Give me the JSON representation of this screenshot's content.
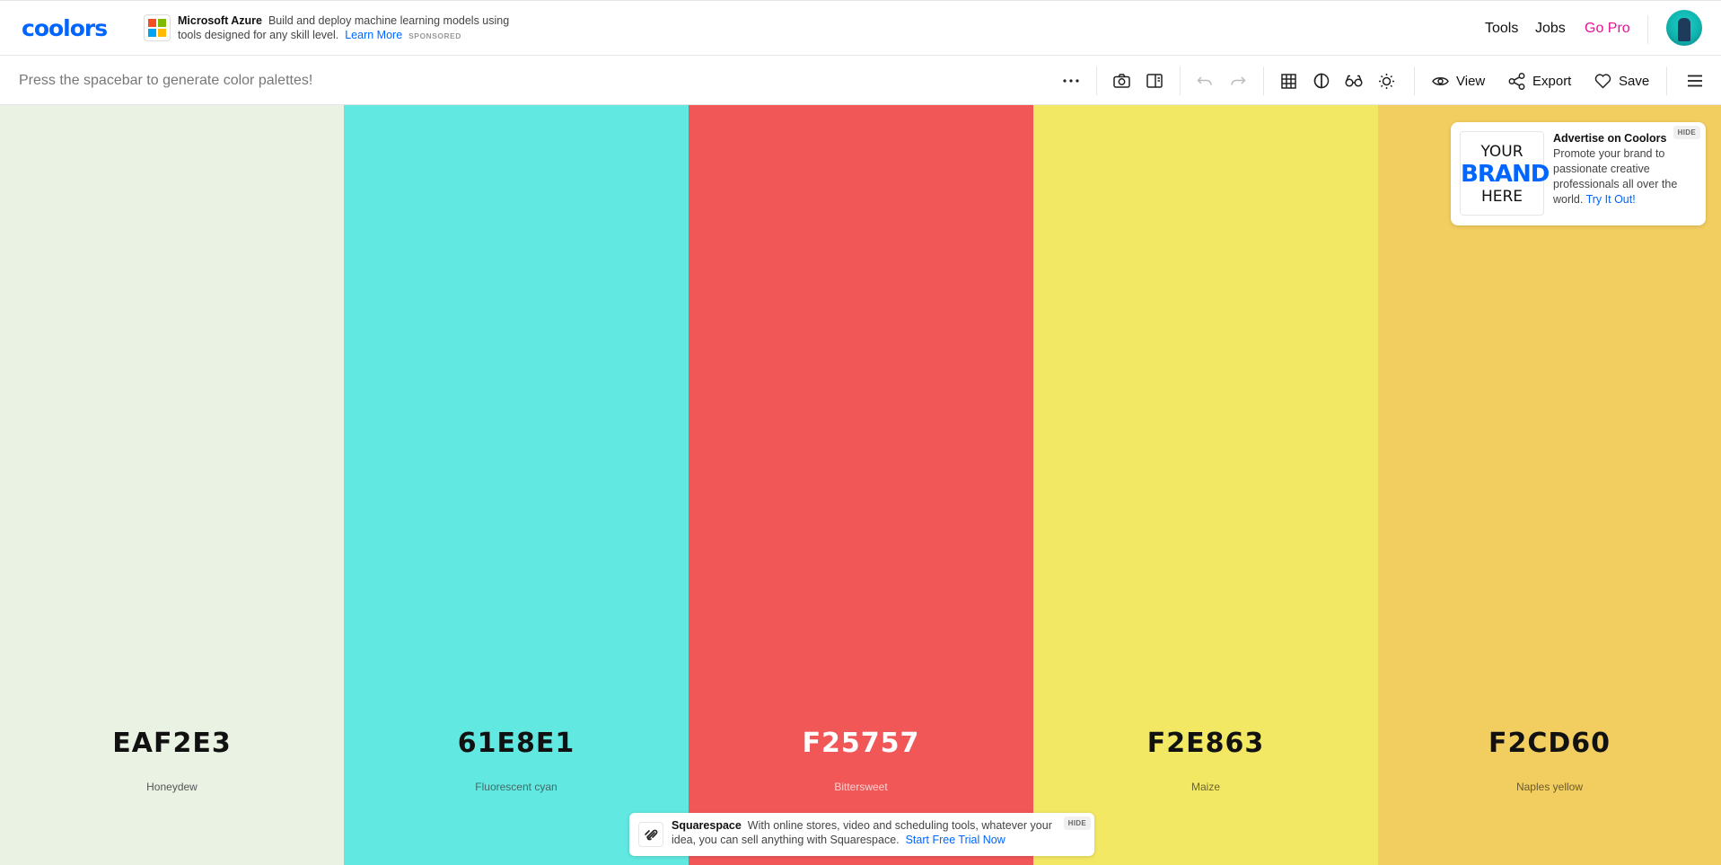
{
  "nav": {
    "logo": "coolors",
    "sponsor": {
      "brand": "Microsoft Azure",
      "text": "Build and deploy machine learning models using tools designed for any skill level.",
      "link": "Learn More",
      "tag": "SPONSORED"
    },
    "links": {
      "tools": "Tools",
      "jobs": "Jobs",
      "gopro": "Go Pro"
    }
  },
  "toolbar": {
    "hint": "Press the spacebar to generate color palettes!",
    "view": "View",
    "export": "Export",
    "save": "Save"
  },
  "palette": [
    {
      "hex": "EAF2E3",
      "name": "Honeydew",
      "bg": "#EAF2E3",
      "fg": "#111111",
      "sub": "#555555"
    },
    {
      "hex": "61E8E1",
      "name": "Fluorescent cyan",
      "bg": "#61E8E1",
      "fg": "#111111",
      "sub": "#3f6b69"
    },
    {
      "hex": "F25757",
      "name": "Bittersweet",
      "bg": "#F25757",
      "fg": "#ffffff",
      "sub": "#fbd0d0"
    },
    {
      "hex": "F2E863",
      "name": "Maize",
      "bg": "#F2E863",
      "fg": "#111111",
      "sub": "#6b6630"
    },
    {
      "hex": "F2CD60",
      "name": "Naples yellow",
      "bg": "#F2CD60",
      "fg": "#111111",
      "sub": "#6b5a2c"
    }
  ],
  "ad": {
    "img": {
      "l1": "YOUR",
      "l2": "BRAND",
      "l3": "HERE"
    },
    "title": "Advertise on Coolors",
    "body": "Promote your brand to passionate creative professionals all over the world.",
    "link": "Try It Out!",
    "hide": "HIDE"
  },
  "bottom_ad": {
    "brand": "Squarespace",
    "text": "With online stores, video and scheduling tools, whatever your idea, you can sell anything with Squarespace.",
    "link": "Start Free Trial Now",
    "hide": "HIDE"
  },
  "colors": {
    "accent": "#0066ff",
    "pro": "#e8139a"
  },
  "icons": [
    "more-icon",
    "camera-icon",
    "panel-icon",
    "undo-icon",
    "redo-icon",
    "grid-icon",
    "contrast-icon",
    "glasses-icon",
    "sun-icon",
    "eye-icon",
    "share-icon",
    "heart-icon",
    "menu-icon"
  ]
}
